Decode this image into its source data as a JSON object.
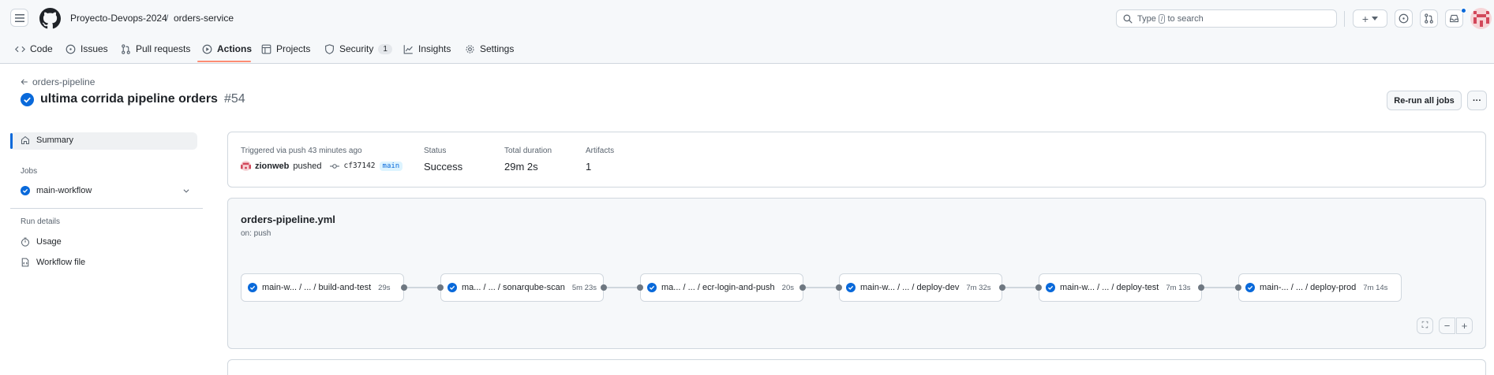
{
  "header": {
    "owner": "Proyecto-Devops-2024",
    "separator": "/",
    "repo": "orders-service",
    "search_prefix": "Type",
    "search_key": "/",
    "search_suffix": "to search",
    "plus_label": "+"
  },
  "nav": {
    "tabs": [
      {
        "label": "Code",
        "icon": "code-icon"
      },
      {
        "label": "Issues",
        "icon": "issue-opened-icon"
      },
      {
        "label": "Pull requests",
        "icon": "git-pull-request-icon"
      },
      {
        "label": "Actions",
        "icon": "play-icon",
        "active": true
      },
      {
        "label": "Projects",
        "icon": "table-icon"
      },
      {
        "label": "Security",
        "icon": "shield-icon",
        "counter": "1"
      },
      {
        "label": "Insights",
        "icon": "graph-icon"
      },
      {
        "label": "Settings",
        "icon": "gear-icon"
      }
    ]
  },
  "run": {
    "back_label": "orders-pipeline",
    "title": "ultima corrida pipeline orders",
    "number": "#54",
    "rerun_label": "Re-run all jobs",
    "more_label": "···"
  },
  "sidebar": {
    "summary_label": "Summary",
    "jobs_heading": "Jobs",
    "job_label": "main-workflow",
    "run_details_heading": "Run details",
    "usage_label": "Usage",
    "workflow_file_label": "Workflow file"
  },
  "summary": {
    "trigger_text": "Triggered via push 43 minutes ago",
    "actor": "zionweb",
    "action": "pushed",
    "commit": "cf37142",
    "branch": "main",
    "status_label": "Status",
    "status_value": "Success",
    "duration_label": "Total duration",
    "duration_value": "29m 2s",
    "artifacts_label": "Artifacts",
    "artifacts_value": "1"
  },
  "graph": {
    "file": "orders-pipeline.yml",
    "trigger": "on: push",
    "jobs": [
      {
        "name": "main-w... / ... / build-and-test",
        "duration": "29s"
      },
      {
        "name": "ma... / ... / sonarqube-scan",
        "duration": "5m 23s"
      },
      {
        "name": "ma... / ... / ecr-login-and-push",
        "duration": "20s"
      },
      {
        "name": "main-w... / ... / deploy-dev",
        "duration": "7m 32s"
      },
      {
        "name": "main-w... / ... / deploy-test",
        "duration": "7m 13s"
      },
      {
        "name": "main-... / ... / deploy-prod",
        "duration": "7m 14s"
      }
    ],
    "controls": {
      "fullscreen": "⛶",
      "zoom_out": "−",
      "zoom_in": "+"
    }
  },
  "colors": {
    "accent": "#0969da",
    "success": "#0969da",
    "tab_underline": "#fd8c73",
    "border": "#d0d7de",
    "header_bg": "#f6f8fa"
  }
}
